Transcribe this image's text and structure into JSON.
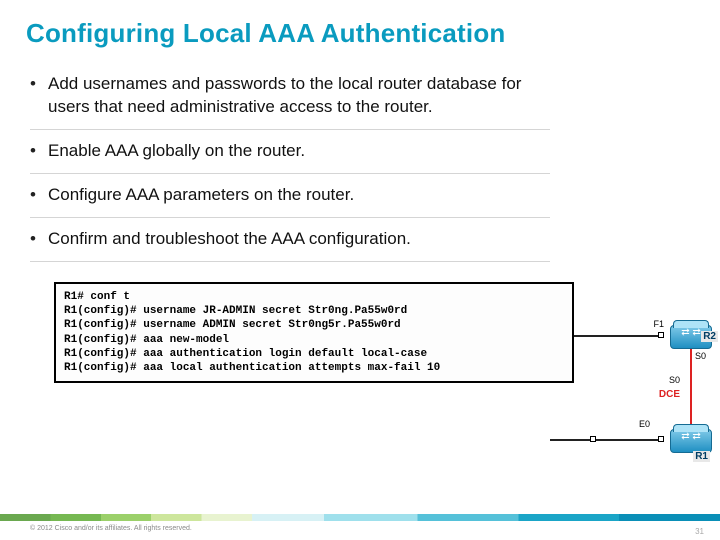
{
  "title": "Configuring Local AAA Authentication",
  "bullets": [
    "Add usernames and passwords to the local router database for users that need administrative access to the router.",
    "Enable AAA globally on the router.",
    "Configure AAA parameters on the router.",
    "Confirm and troubleshoot the AAA configuration."
  ],
  "code": "R1# conf t\nR1(config)# username JR-ADMIN secret Str0ng.Pa55w0rd\nR1(config)# username ADMIN secret Str0ng5r.Pa55w0rd\nR1(config)# aaa new-model\nR1(config)# aaa authentication login default local-case\nR1(config)# aaa local authentication attempts max-fail 10",
  "diagram": {
    "r1": "R1",
    "r2": "R2",
    "f1": "F1",
    "s0": "S0",
    "s0b": "S0",
    "dce": "DCE",
    "e0": "E0"
  },
  "footer": {
    "copyright": "© 2012 Cisco and/or its affiliates. All rights reserved.",
    "page": "31"
  }
}
